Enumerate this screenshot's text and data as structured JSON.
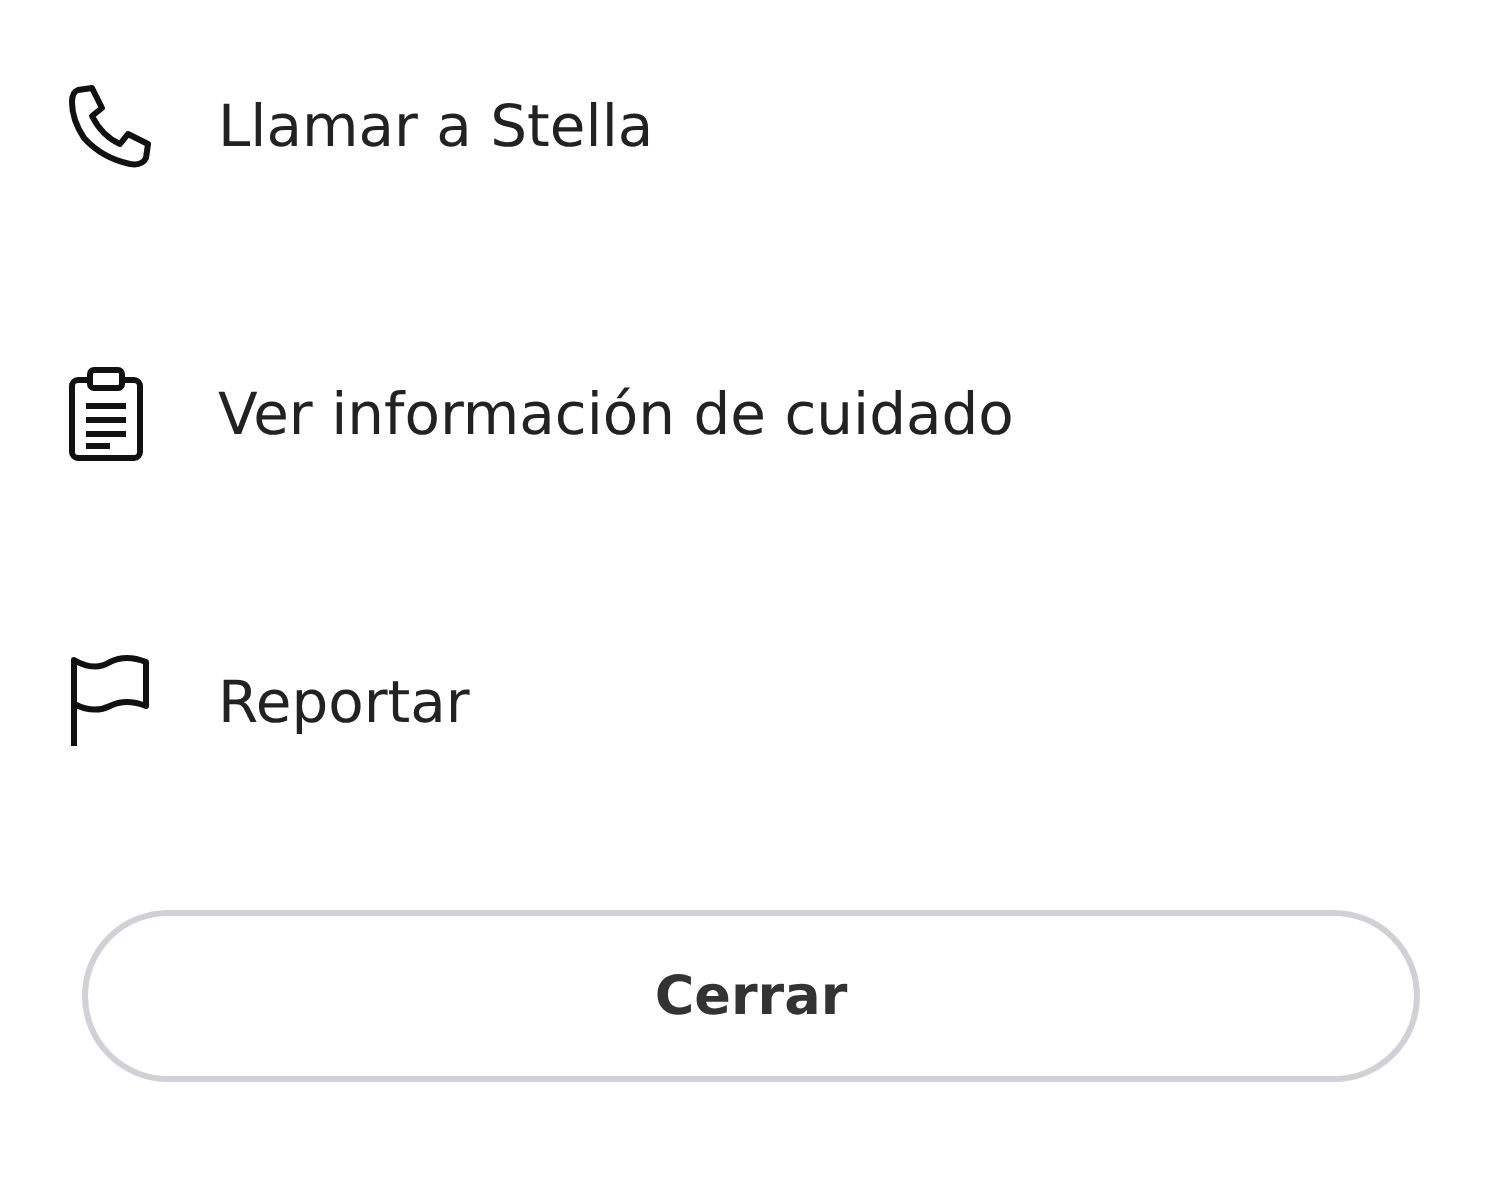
{
  "menu": {
    "items": [
      {
        "kind": "phone",
        "label": "Llamar a Stella"
      },
      {
        "kind": "clipboard",
        "label": "Ver información de cuidado"
      },
      {
        "kind": "flag",
        "label": "Reportar"
      }
    ]
  },
  "close_button": {
    "label": "Cerrar"
  }
}
